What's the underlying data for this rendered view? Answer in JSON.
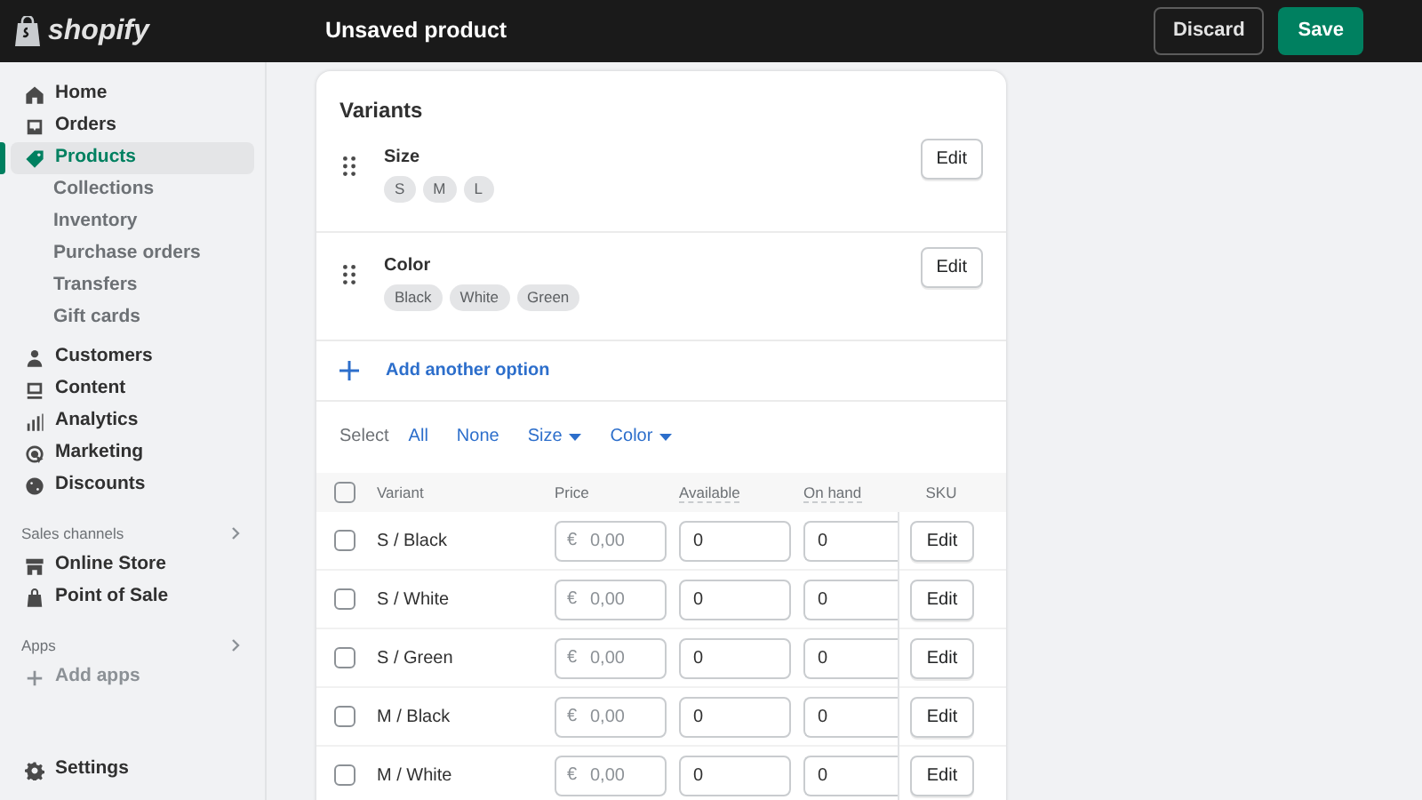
{
  "top_bar": {
    "logo": "shopify",
    "title": "Unsaved product",
    "buttons": [
      {
        "label": "Discard",
        "kind": "secondary"
      },
      {
        "label": "Save",
        "kind": "primary"
      }
    ]
  },
  "sidebar": {
    "items": [
      {
        "label": "Home",
        "selected": false
      },
      {
        "label": "Orders",
        "selected": false
      },
      {
        "label": "Products",
        "selected": true,
        "children": [
          {
            "label": "Collections",
            "selected": false
          },
          {
            "label": "Inventory",
            "selected": false
          },
          {
            "label": "Purchase orders",
            "selected": false
          },
          {
            "label": "Transfers",
            "selected": false
          },
          {
            "label": "Gift cards",
            "selected": false
          }
        ]
      },
      {
        "label": "Customers",
        "selected": false
      },
      {
        "label": "Content",
        "selected": false
      },
      {
        "label": "Analytics",
        "selected": false
      },
      {
        "label": "Marketing",
        "selected": false
      },
      {
        "label": "Discounts",
        "selected": false
      }
    ],
    "sections": [
      {
        "title": "Sales channels",
        "items": [
          {
            "label": "Online Store",
            "selected": false
          },
          {
            "label": "Point of Sale",
            "selected": false
          }
        ]
      },
      {
        "title": "Apps",
        "items": [
          {
            "label": "Add apps",
            "selected": false,
            "kind": "add"
          }
        ]
      }
    ],
    "settings": {
      "label": "Settings",
      "selected": false
    }
  },
  "variants": {
    "title": "Variants",
    "options": [
      {
        "name": "Size",
        "values": [
          "S",
          "M",
          "L"
        ],
        "button": "Edit"
      },
      {
        "name": "Color",
        "values": [
          "Black",
          "White",
          "Green"
        ],
        "button": "Edit"
      }
    ],
    "add_option": "Add another option",
    "select": {
      "label": "Select",
      "links": [
        {
          "label": "All",
          "dropdown": false
        },
        {
          "label": "None",
          "dropdown": false
        },
        {
          "label": "Size",
          "dropdown": true
        },
        {
          "label": "Color",
          "dropdown": true
        }
      ]
    },
    "table": {
      "select_all_checked": false,
      "columns": [
        "Variant",
        "Price",
        "Available",
        "On hand",
        "SKU"
      ],
      "rows": [
        {
          "checked": false,
          "variant": "S / Black",
          "currency": "€",
          "price_placeholder": "0,00",
          "available": "0",
          "on_hand": "0",
          "button": "Edit"
        },
        {
          "checked": false,
          "variant": "S / White",
          "currency": "€",
          "price_placeholder": "0,00",
          "available": "0",
          "on_hand": "0",
          "button": "Edit"
        },
        {
          "checked": false,
          "variant": "S / Green",
          "currency": "€",
          "price_placeholder": "0,00",
          "available": "0",
          "on_hand": "0",
          "button": "Edit"
        },
        {
          "checked": false,
          "variant": "M / Black",
          "currency": "€",
          "price_placeholder": "0,00",
          "available": "0",
          "on_hand": "0",
          "button": "Edit"
        },
        {
          "checked": false,
          "variant": "M / White",
          "currency": "€",
          "price_placeholder": "0,00",
          "available": "0",
          "on_hand": "0",
          "button": "Edit"
        }
      ]
    }
  }
}
